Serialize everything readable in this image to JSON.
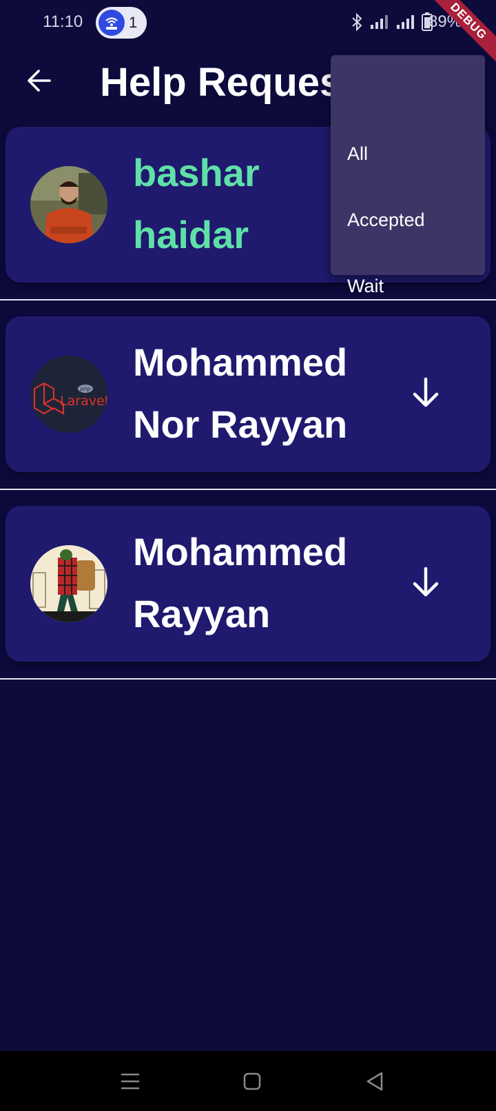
{
  "status_bar": {
    "time": "11:10",
    "hotspot_count": "1",
    "battery": "89%"
  },
  "debug_banner": "DEBUG",
  "app_bar": {
    "title": "Help Requests",
    "back_icon": "arrow-left-icon"
  },
  "filter_menu": {
    "items": [
      {
        "label": "All"
      },
      {
        "label": "Accepted"
      },
      {
        "label": "Wait"
      }
    ]
  },
  "requests": [
    {
      "first": "bashar",
      "second": "haidar",
      "highlighted": true,
      "avatar": "man-portrait"
    },
    {
      "first": "Mohammed",
      "second": "Nor Rayyan",
      "highlighted": false,
      "avatar": "laravel-logo"
    },
    {
      "first": "Mohammed",
      "second": "Rayyan",
      "highlighted": false,
      "avatar": "cartoon-backpacker"
    }
  ],
  "colors": {
    "background": "#0d0a3c",
    "card": "#1f1a6e",
    "accent_name": "#5fe0a8",
    "menu": "#3d3566",
    "debug": "#a8203a"
  }
}
